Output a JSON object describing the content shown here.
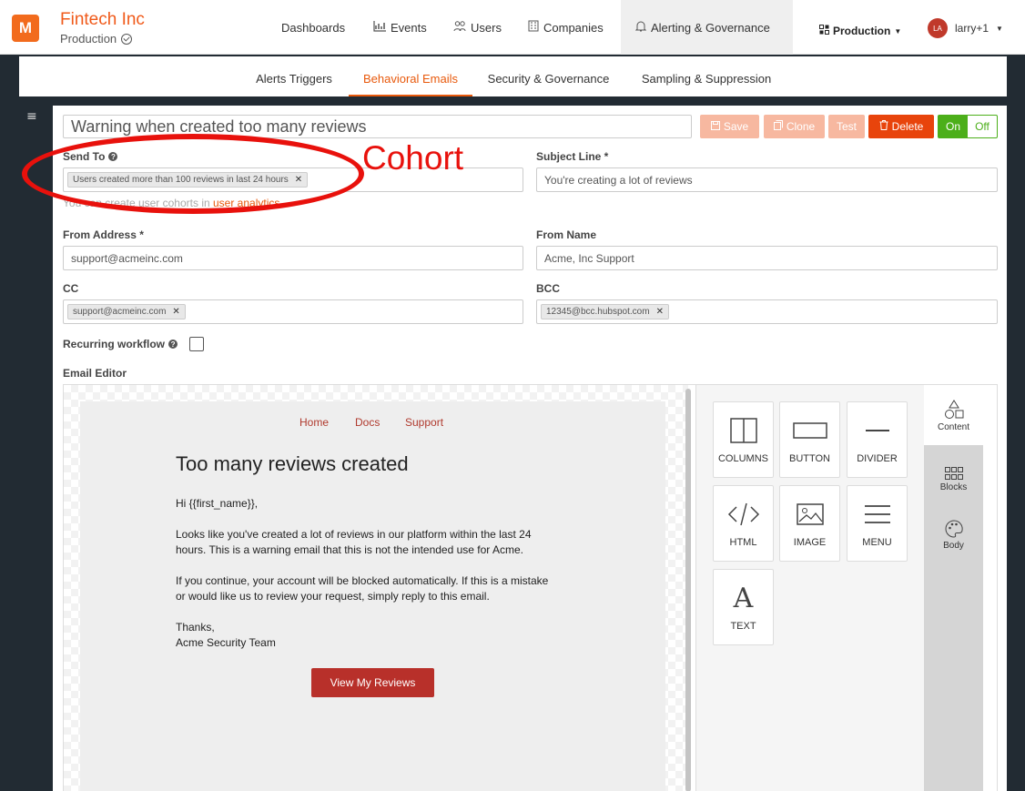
{
  "brand": {
    "name": "Fintech Inc",
    "env": "Production",
    "logo_letter": "M"
  },
  "nav": [
    {
      "label": "Dashboards",
      "icon": ""
    },
    {
      "label": "Events",
      "icon": "chart-icon"
    },
    {
      "label": "Users",
      "icon": "users-icon"
    },
    {
      "label": "Companies",
      "icon": "building-icon"
    },
    {
      "label": "Alerting & Governance",
      "icon": "bell-icon"
    }
  ],
  "env_dropdown": "Production",
  "user": {
    "initials": "LA",
    "name": "larry+1"
  },
  "subnav": [
    "Alerts Triggers",
    "Behavioral Emails",
    "Security & Governance",
    "Sampling & Suppression"
  ],
  "form": {
    "title": "Warning when created too many reviews",
    "buttons": {
      "save": "Save",
      "clone": "Clone",
      "test": "Test",
      "delete": "Delete",
      "on": "On",
      "off": "Off"
    },
    "send_to": {
      "label": "Send To",
      "tag": "Users created more than 100 reviews in last 24 hours",
      "hint": "You can create user cohorts in",
      "hint_link": "user analytics"
    },
    "subject": {
      "label": "Subject Line *",
      "value": "You're creating a lot of reviews"
    },
    "from_address": {
      "label": "From Address *",
      "value": "support@acmeinc.com"
    },
    "from_name": {
      "label": "From Name",
      "value": "Acme, Inc Support"
    },
    "cc": {
      "label": "CC",
      "tag": "support@acmeinc.com"
    },
    "bcc": {
      "label": "BCC",
      "tag": "12345@bcc.hubspot.com"
    },
    "recurring": {
      "label": "Recurring workflow"
    },
    "editor_label": "Email Editor"
  },
  "email": {
    "nav": [
      "Home",
      "Docs",
      "Support"
    ],
    "heading": "Too many reviews created",
    "greeting": "Hi {{first_name}},",
    "para1_l1": "Looks like you've created a lot of reviews in our platform within the last 24",
    "para1_l2": "hours. This is a warning email that this is not the intended use for Acme.",
    "para2_l1": "If you continue, your account will be blocked automatically. If this is a mistake",
    "para2_l2": "or would like us to review your request, simply reply to this email.",
    "thanks": "Thanks,",
    "signature": "Acme Security Team",
    "cta": "View My Reviews"
  },
  "tools": [
    "COLUMNS",
    "BUTTON",
    "DIVIDER",
    "HTML",
    "IMAGE",
    "MENU",
    "TEXT"
  ],
  "side_tabs": [
    "Content",
    "Blocks",
    "Body"
  ],
  "annotation": "Cohort",
  "colors": {
    "accent": "#e8590c",
    "delete": "#e8440c",
    "toggle": "#4caf1a",
    "cta": "#b8302a",
    "annotation": "#e8110c"
  }
}
